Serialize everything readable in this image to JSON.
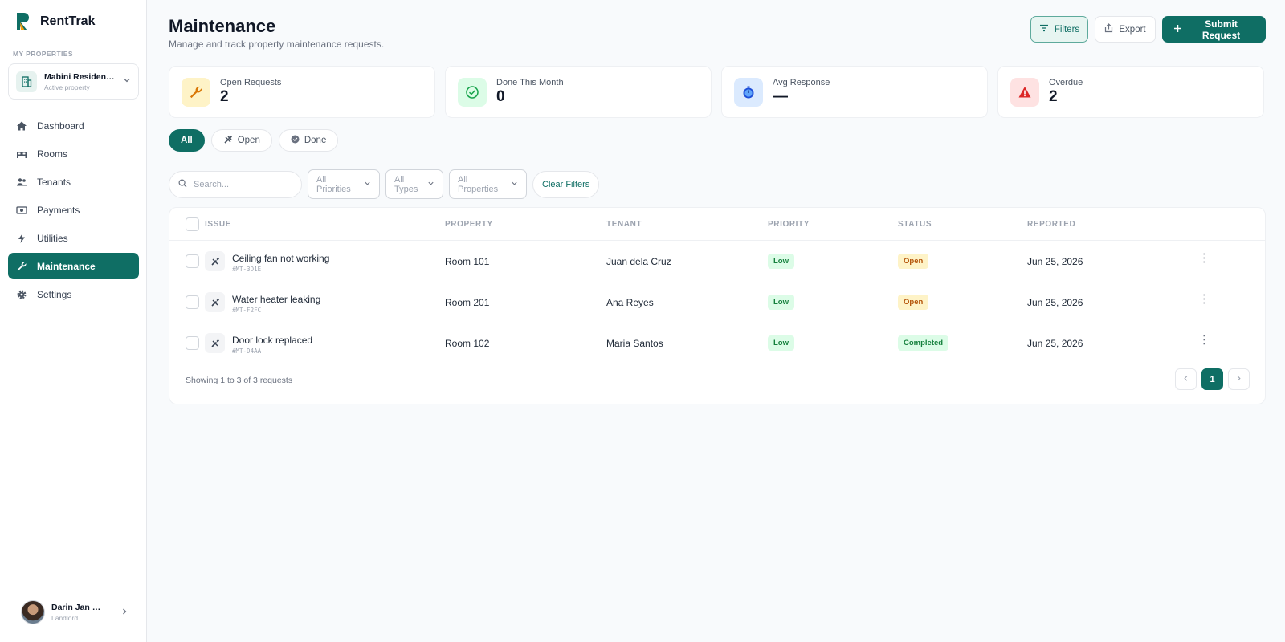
{
  "brand": {
    "name": "RentTrak",
    "accent": "#0f6e64"
  },
  "sidebar": {
    "section_label": "MY PROPERTIES",
    "property": {
      "name": "Mabini Residences",
      "status": "Active property"
    },
    "nav": [
      {
        "label": "Dashboard",
        "icon": "home-icon"
      },
      {
        "label": "Rooms",
        "icon": "bed-icon"
      },
      {
        "label": "Tenants",
        "icon": "users-icon"
      },
      {
        "label": "Payments",
        "icon": "money-icon"
      },
      {
        "label": "Utilities",
        "icon": "bolt-icon"
      },
      {
        "label": "Maintenance",
        "icon": "wrench-icon",
        "active": true
      },
      {
        "label": "Settings",
        "icon": "gear-icon"
      }
    ],
    "user": {
      "name": "Darin Jan Santos",
      "role": "Landlord"
    }
  },
  "header": {
    "title": "Maintenance",
    "subtitle": "Manage and track property maintenance requests.",
    "filters_label": "Filters",
    "export_label": "Export",
    "submit_label": "Submit Request"
  },
  "stats": [
    {
      "label": "Open Requests",
      "value": "2"
    },
    {
      "label": "Done This Month",
      "value": "0"
    },
    {
      "label": "Avg Response",
      "value": "—"
    },
    {
      "label": "Overdue",
      "value": "2"
    }
  ],
  "tabs": [
    {
      "label": "All"
    },
    {
      "label": "Open"
    },
    {
      "label": "Done"
    }
  ],
  "filters": {
    "search_placeholder": "Search...",
    "priorities": "All Priorities",
    "types": "All Types",
    "properties": "All Properties",
    "clear": "Clear Filters"
  },
  "table": {
    "columns": [
      "ISSUE",
      "PROPERTY",
      "TENANT",
      "PRIORITY",
      "STATUS",
      "REPORTED"
    ],
    "rows": [
      {
        "title": "Ceiling fan not working",
        "id": "#MT-3D1E",
        "property": "Room 101",
        "tenant": "Juan dela Cruz",
        "priority": "Low",
        "status": "Open",
        "reported": "Jun 25, 2026"
      },
      {
        "title": "Water heater leaking",
        "id": "#MT-F2FC",
        "property": "Room 201",
        "tenant": "Ana Reyes",
        "priority": "Low",
        "status": "Open",
        "reported": "Jun 25, 2026"
      },
      {
        "title": "Door lock replaced",
        "id": "#MT-D4AA",
        "property": "Room 102",
        "tenant": "Maria Santos",
        "priority": "Low",
        "status": "Completed",
        "reported": "Jun 25, 2026"
      }
    ],
    "footer": "Showing 1 to 3 of 3 requests",
    "current_page": "1"
  }
}
